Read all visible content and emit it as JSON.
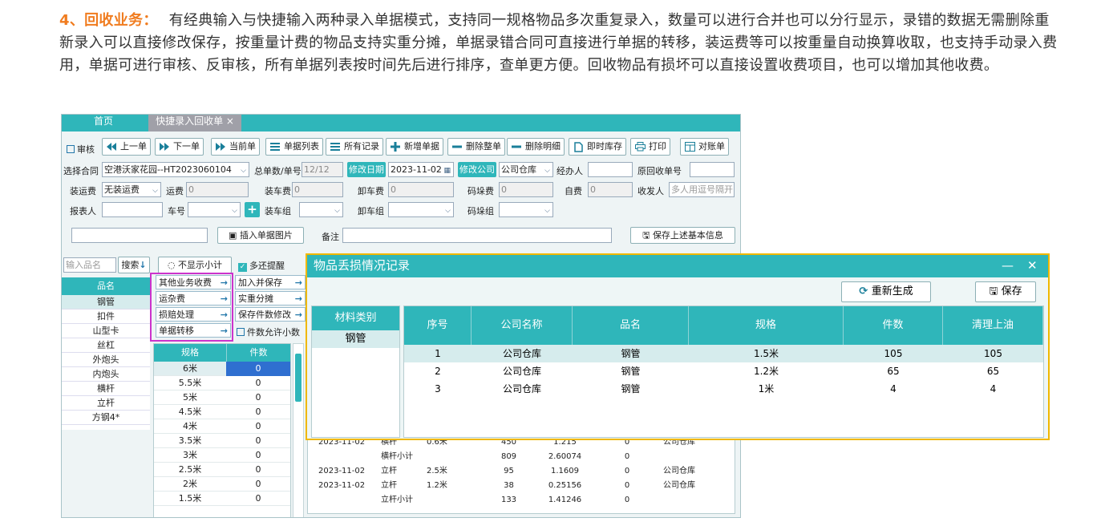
{
  "article": {
    "heading": "4、回收业务：",
    "body": "有经典输入与快捷输入两种录入单据模式，支持同一规格物品多次重复录入，数量可以进行合并也可以分行显示，录错的数据无需删除重新录入可以直接修改保存，按重量计费的物品支持实重分摊，单据录错合同可直接进行单据的转移，装运费等可以按重量自动换算收取，也支持手动录入费用，单据可进行审核、反审核，所有单据列表按时间先后进行排序，查单更方便。回收物品有损坏可以直接设置收费项目，也可以增加其他收费。"
  },
  "app": {
    "tabs": [
      "首页",
      "快捷录入回收单 ×"
    ],
    "toolbar": {
      "review": "审核",
      "buttons": [
        "上一单",
        "下一单",
        "当前单",
        "单据列表",
        "所有记录",
        "新增单据",
        "删除整单",
        "删除明细",
        "即时库存",
        "打印",
        "对账单"
      ]
    },
    "form": {
      "contract_label": "选择合同",
      "contract_value": "空港沃家花园--HT2023060104",
      "total_label": "总单数/单号",
      "total_value": "12/12",
      "date_btn": "修改日期",
      "date_value": "2023-11-02",
      "company_btn": "修改公司",
      "company_value": "公司仓库",
      "handler_label": "经办人",
      "orig_label": "原回收单号",
      "ship_label": "装运费",
      "ship_value": "无装运费",
      "freight_label": "运费",
      "freight_value": "0",
      "load_label": "装车费",
      "load_value": "0",
      "unload_label": "卸车费",
      "unload_value": "0",
      "stack_label": "码垛费",
      "stack_value": "0",
      "self_label": "自费",
      "self_value": "0",
      "sender_label": "收发人",
      "sender_placeholder": "多人用逗号隔开",
      "reporter_label": "报表人",
      "car_label": "车号",
      "load_group_label": "装车组",
      "unload_group_label": "卸车组",
      "stack_group_label": "码垛组",
      "insert_image": "插入单据图片",
      "note_label": "备注",
      "save_basic": "保存上述基本信息"
    },
    "left": {
      "search_placeholder": "输入品名",
      "search_btn": "搜索",
      "header": "品名",
      "items": [
        "钢管",
        "扣件",
        "山型卡",
        "丝杠",
        "外炮头",
        "内炮头",
        "横杆",
        "立杆",
        "方钢4*"
      ]
    },
    "options": {
      "hide_subtotal": "不显示小计",
      "multi_remind": "多还提醒",
      "left_ops": [
        "其他业务收费",
        "运杂费",
        "损赔处理",
        "单据转移"
      ],
      "right_ops": [
        "加入并保存",
        "实重分摊",
        "保存件数修改"
      ],
      "decimal": "件数允许小数"
    },
    "spec_grid": {
      "headers": [
        "规格",
        "件数"
      ],
      "rows": [
        [
          "6米",
          "0"
        ],
        [
          "5.5米",
          "0"
        ],
        [
          "5米",
          "0"
        ],
        [
          "4.5米",
          "0"
        ],
        [
          "4米",
          "0"
        ],
        [
          "3.5米",
          "0"
        ],
        [
          "3米",
          "0"
        ],
        [
          "2.5米",
          "0"
        ],
        [
          "2米",
          "0"
        ],
        [
          "1.5米",
          "0"
        ]
      ]
    },
    "bg_table": {
      "rows": [
        [
          "2023-11-02",
          "横杆",
          "0.6米",
          "450",
          "1.215",
          "0",
          "公司仓库"
        ],
        [
          "",
          "横杆小计",
          "",
          "809",
          "2.60074",
          "0",
          ""
        ],
        [
          "2023-11-02",
          "立杆",
          "2.5米",
          "95",
          "1.1609",
          "0",
          "公司仓库"
        ],
        [
          "2023-11-02",
          "立杆",
          "1.2米",
          "38",
          "0.25156",
          "0",
          "公司仓库"
        ],
        [
          "",
          "立杆小计",
          "",
          "133",
          "1.41246",
          "0",
          ""
        ]
      ]
    }
  },
  "dialog": {
    "title": "物品丢损情况记录",
    "regen": "重新生成",
    "save": "保存",
    "category_header": "材料类别",
    "category_value": "钢管",
    "headers": [
      "序号",
      "公司名称",
      "品名",
      "规格",
      "件数",
      "清理上油"
    ],
    "rows": [
      [
        "1",
        "公司仓库",
        "钢管",
        "1.5米",
        "105",
        "105"
      ],
      [
        "2",
        "公司仓库",
        "钢管",
        "1.2米",
        "65",
        "65"
      ],
      [
        "3",
        "公司仓库",
        "钢管",
        "1米",
        "4",
        "4"
      ]
    ]
  }
}
